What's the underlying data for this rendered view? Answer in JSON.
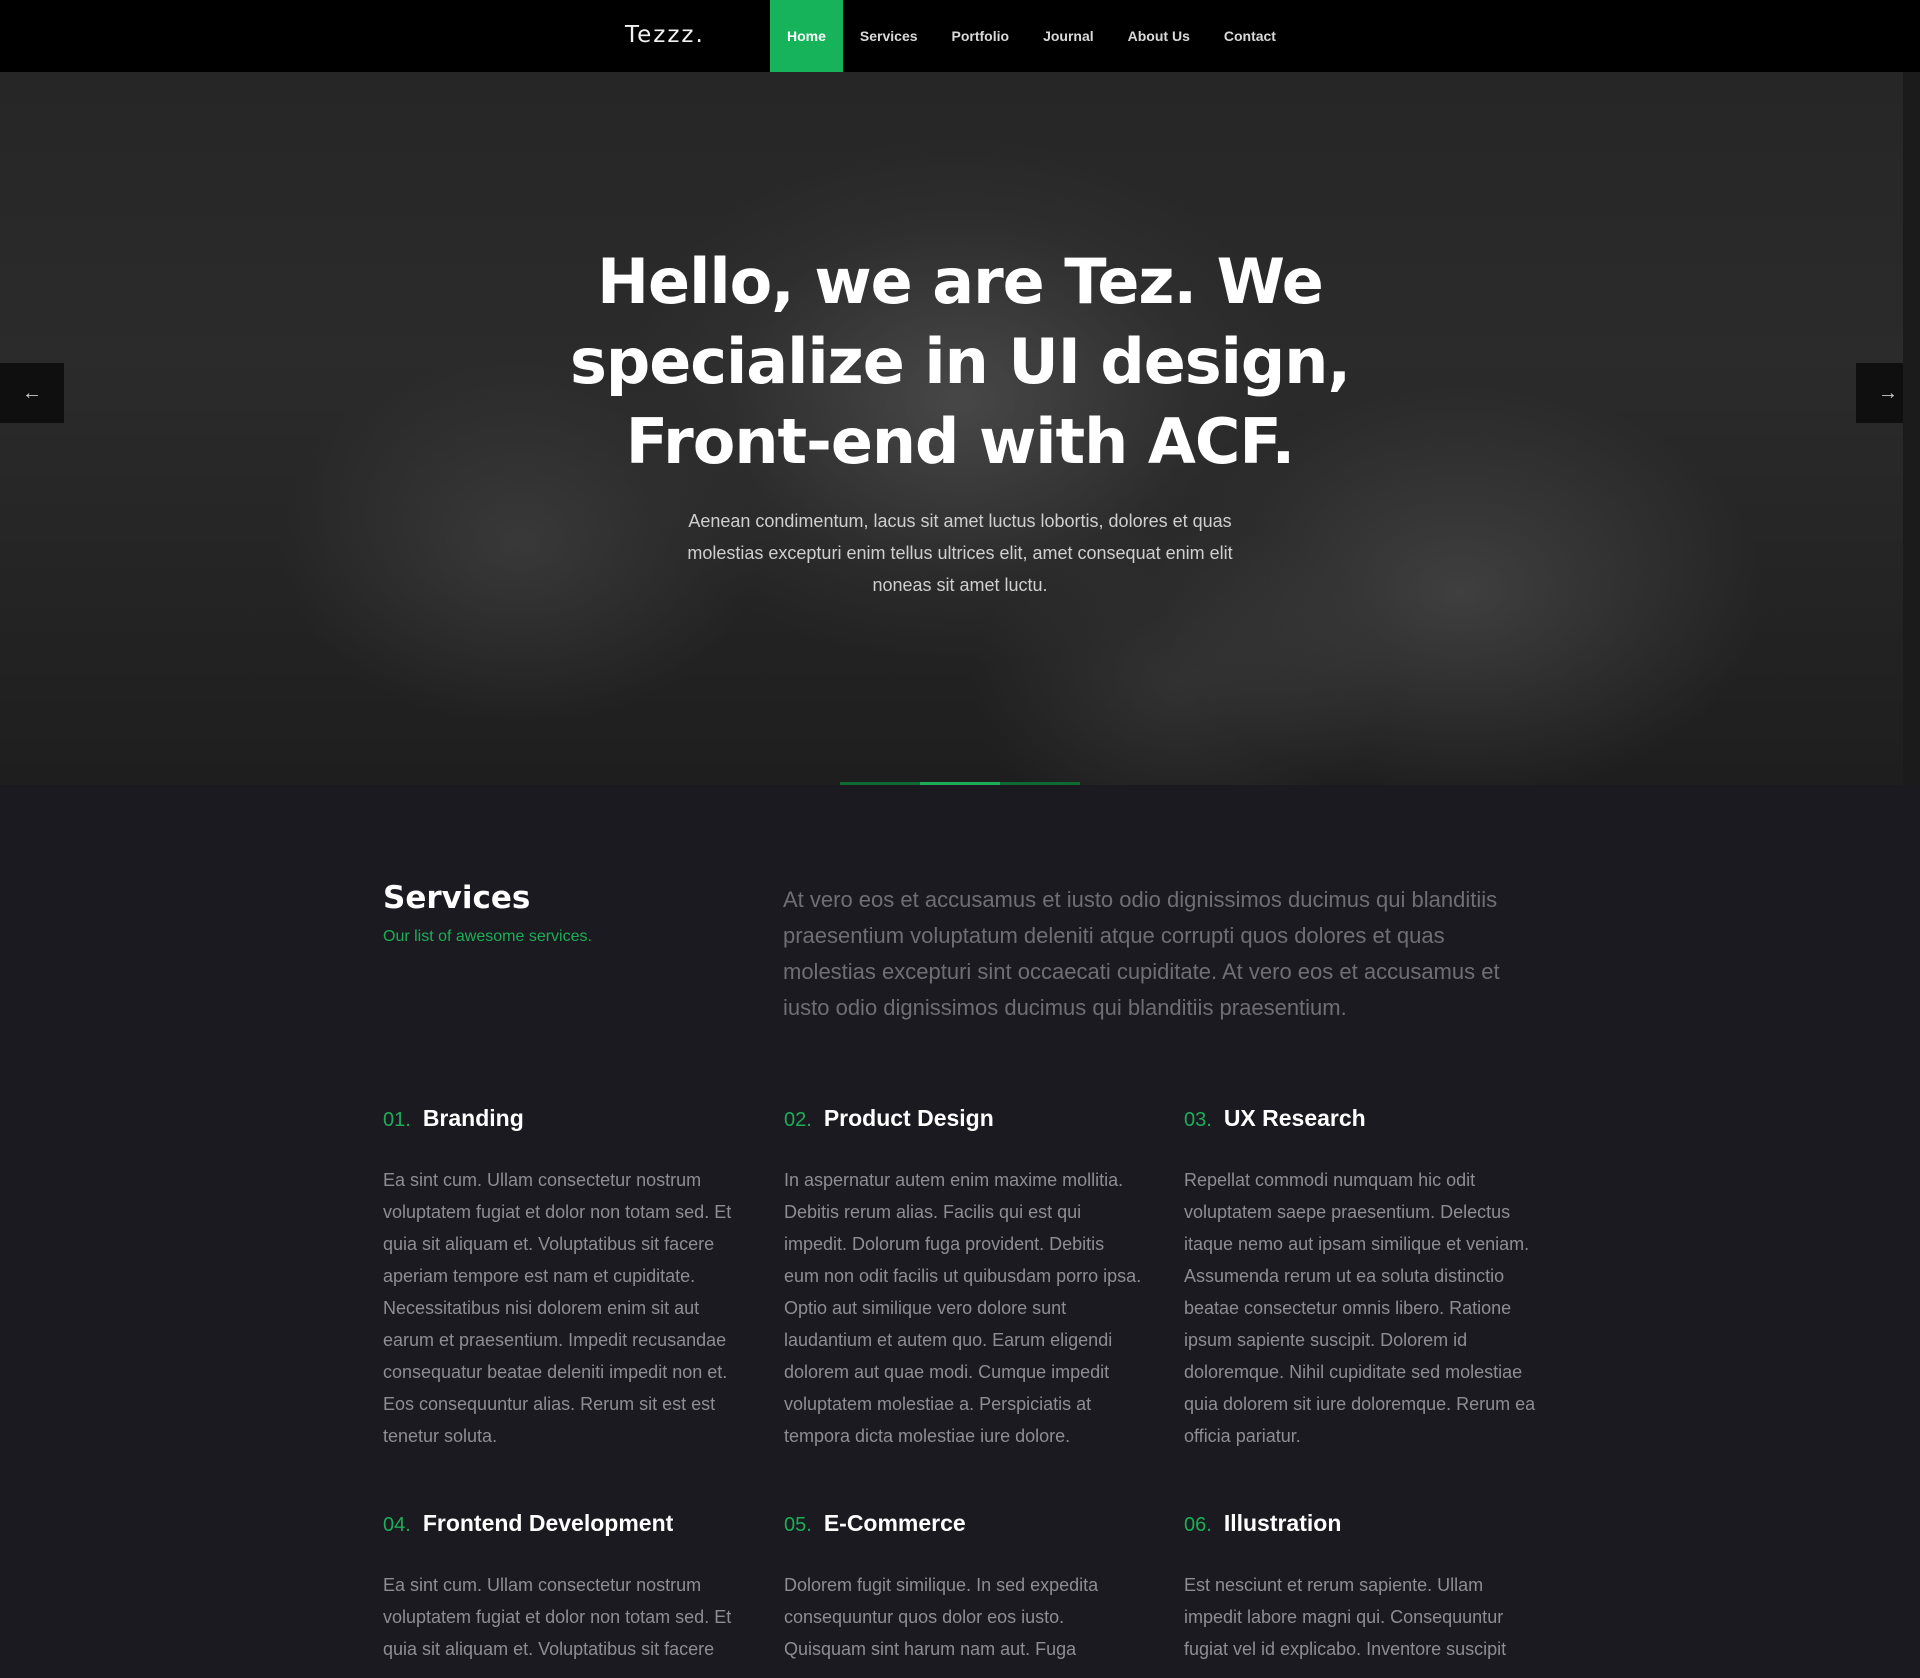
{
  "header": {
    "logo": "Tezzz.",
    "nav": [
      {
        "label": "Home",
        "active": true
      },
      {
        "label": "Services",
        "active": false
      },
      {
        "label": "Portfolio",
        "active": false
      },
      {
        "label": "Journal",
        "active": false
      },
      {
        "label": "About Us",
        "active": false
      },
      {
        "label": "Contact",
        "active": false
      }
    ]
  },
  "hero": {
    "title": "Hello, we are Tez. We specialize in UI design, Front-end with ACF.",
    "text": "Aenean condimentum, lacus sit amet luctus lobortis, dolores et quas molestias excepturi enim tellus ultrices elit, amet consequat enim elit noneas sit amet luctu.",
    "prev_icon": "arrow-left-icon",
    "next_icon": "arrow-right-icon",
    "slides_count": 3,
    "active_slide": 2
  },
  "services": {
    "title": "Services",
    "subtitle": "Our list of awesome services.",
    "intro": "At vero eos et accusamus et iusto odio dignissimos ducimus qui blanditiis praesentium voluptatum deleniti atque corrupti quos dolores et quas molestias excepturi sint occaecati cupiditate. At vero eos et accusamus et iusto odio dignissimos ducimus qui blanditiis praesentium.",
    "items": [
      {
        "num": "01.",
        "title": "Branding",
        "text": "Ea sint cum. Ullam consectetur nostrum voluptatem fugiat et dolor non totam sed. Et quia sit aliquam et. Voluptatibus sit facere aperiam tempore est nam et cupiditate. Necessitatibus nisi dolorem enim sit aut earum et praesentium. Impedit recusandae consequatur beatae deleniti impedit non et. Eos consequuntur alias. Rerum sit est est tenetur soluta."
      },
      {
        "num": "02.",
        "title": "Product Design",
        "text": "In aspernatur autem enim maxime mollitia. Debitis rerum alias. Facilis qui est qui impedit. Dolorum fuga provident. Debitis eum non odit facilis ut quibusdam porro ipsa. Optio aut similique vero dolore sunt laudantium et autem quo. Earum eligendi dolorem aut quae modi. Cumque impedit voluptatem molestiae a. Perspiciatis at tempora dicta molestiae iure dolore."
      },
      {
        "num": "03.",
        "title": "UX Research",
        "text": "Repellat commodi numquam hic odit voluptatem saepe praesentium. Delectus itaque nemo aut ipsam similique et veniam. Assumenda rerum ut ea soluta distinctio beatae consectetur omnis libero. Ratione ipsum sapiente suscipit. Dolorem id doloremque. Nihil cupiditate sed molestiae quia dolorem sit iure doloremque. Rerum ea officia pariatur."
      },
      {
        "num": "04.",
        "title": "Frontend Development",
        "text": "Ea sint cum. Ullam consectetur nostrum voluptatem fugiat et dolor non totam sed. Et quia sit aliquam et. Voluptatibus sit facere"
      },
      {
        "num": "05.",
        "title": "E-Commerce",
        "text": "Dolorem fugit similique. In sed expedita consequuntur quos dolor eos iusto. Quisquam sint harum nam aut. Fuga"
      },
      {
        "num": "06.",
        "title": "Illustration",
        "text": "Est nesciunt et rerum sapiente. Ullam impedit labore magni qui. Consequuntur fugiat vel id explicabo. Inventore suscipit"
      }
    ]
  },
  "colors": {
    "accent": "#1cae57",
    "header_bg": "#000000",
    "page_bg": "#1a1a20"
  }
}
